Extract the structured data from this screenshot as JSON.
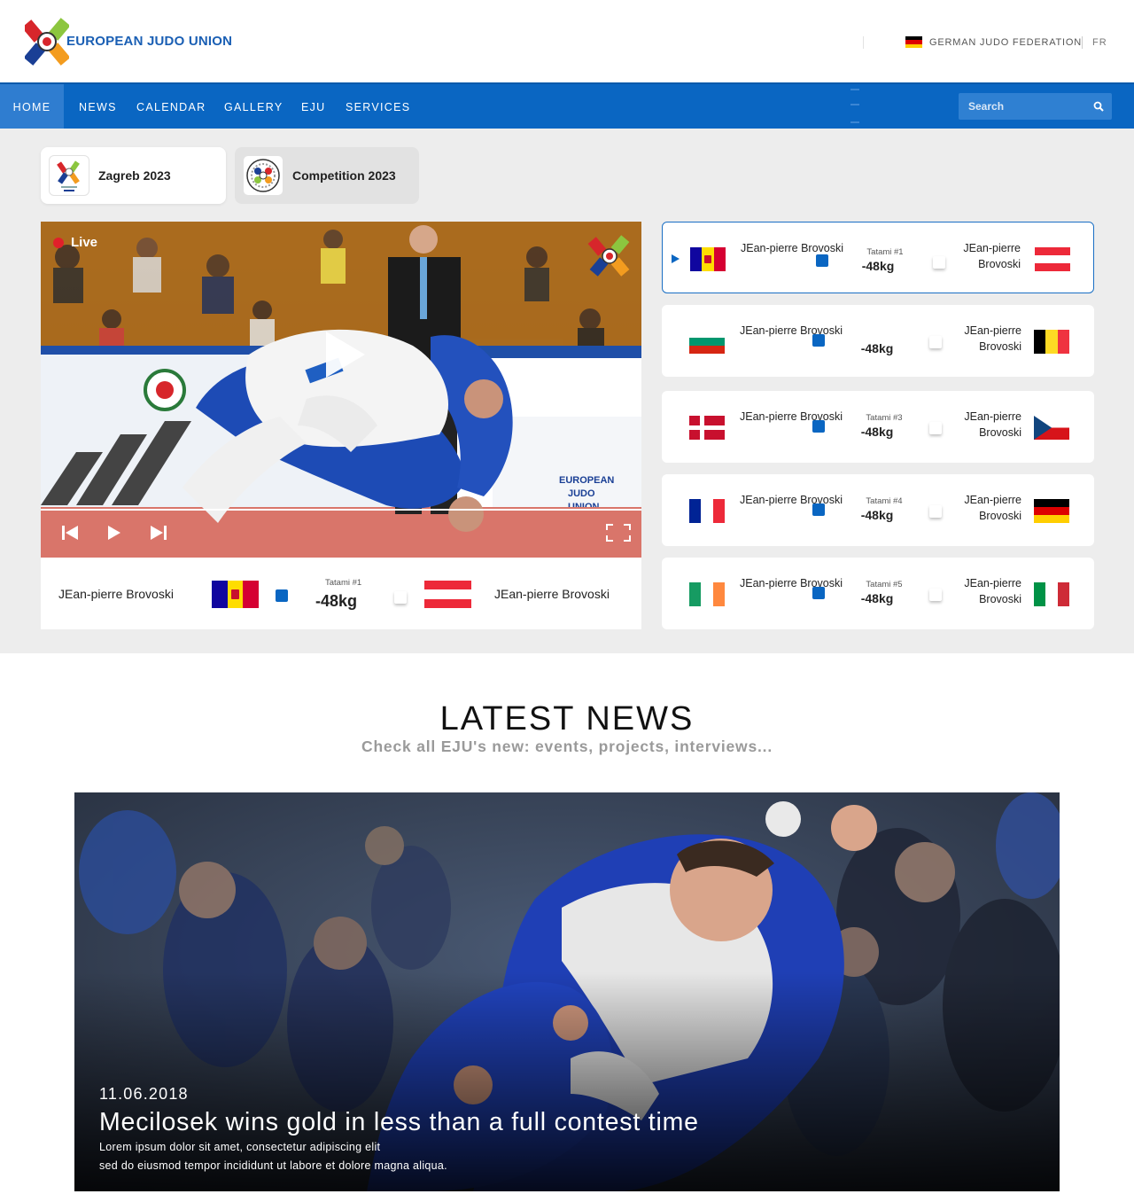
{
  "header": {
    "logo_text": "EUROPEAN JUDO UNION",
    "federation": "GERMAN JUDO FEDERATION",
    "language": "FR"
  },
  "nav": {
    "items": [
      "HOME",
      "NEWS",
      "CALENDAR",
      "GALLERY",
      "EJU",
      "SERVICES"
    ],
    "active": "HOME",
    "search_placeholder": "Search"
  },
  "tabs": [
    "Zagreb 2023",
    "Competition 2023"
  ],
  "live": {
    "label": "Live",
    "left_name": "JEan-pierre Brovoski",
    "right_name": "JEan-pierre Brovoski",
    "tatami": "Tatami #1",
    "weight": "-48kg"
  },
  "matches": [
    {
      "left_name": "JEan-pierre Brovoski",
      "left_flag": "andorra",
      "right_name": "JEan-pierre Brovoski",
      "right_flag": "austria",
      "tatami": "Tatami #1",
      "weight": "-48kg",
      "active": true
    },
    {
      "left_name": "JEan-pierre Brovoski",
      "left_flag": "bulgaria",
      "right_name": "JEan-pierre Brovoski",
      "right_flag": "belgium",
      "tatami": "",
      "weight": "-48kg",
      "active": false
    },
    {
      "left_name": "JEan-pierre Brovoski",
      "left_flag": "denmark",
      "right_name": "JEan-pierre Brovoski",
      "right_flag": "czech",
      "tatami": "Tatami #3",
      "weight": "-48kg",
      "active": false
    },
    {
      "left_name": "JEan-pierre Brovoski",
      "left_flag": "france",
      "right_name": "JEan-pierre Brovoski",
      "right_flag": "germany",
      "tatami": "Tatami #4",
      "weight": "-48kg",
      "active": false
    },
    {
      "left_name": "JEan-pierre Brovoski",
      "left_flag": "ireland",
      "right_name": "JEan-pierre Brovoski",
      "right_flag": "italy",
      "tatami": "Tatami #5",
      "weight": "-48kg",
      "active": false
    }
  ],
  "news": {
    "title": "LATEST NEWS",
    "subtitle": "Check all EJU's new: events, projects, interviews...",
    "date": "11.06.2018",
    "headline": "Mecilosek wins gold in less than a full contest time",
    "excerpt_1": "Lorem ipsum dolor sit amet, consectetur adipiscing elit",
    "excerpt_2": "sed do eiusmod tempor incididunt ut labore et dolore magna aliqua."
  },
  "colors": {
    "brand_blue": "#0a66c2",
    "nav_active": "#2f7dd0",
    "live_red": "#e0202a",
    "section_grey": "#ededed"
  }
}
